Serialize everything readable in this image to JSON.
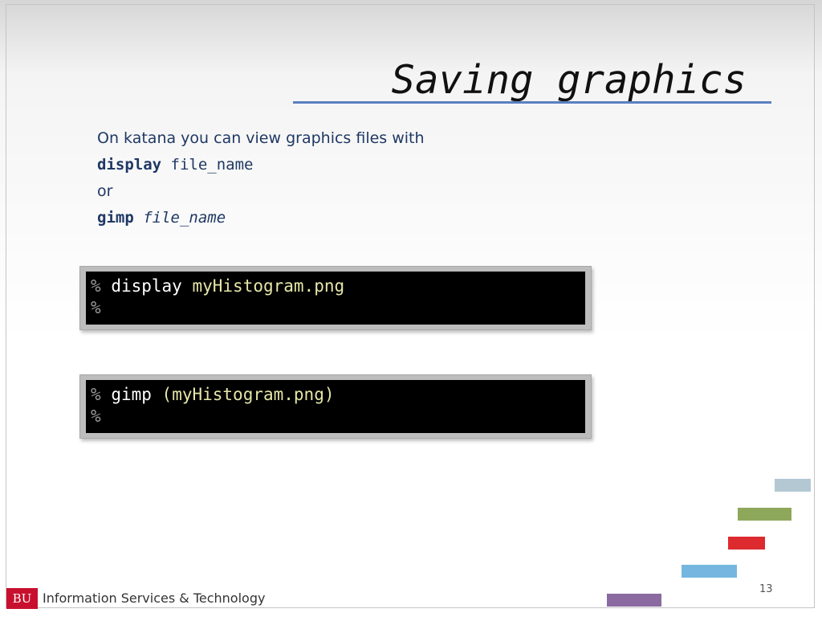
{
  "slide": {
    "title": "Saving graphics",
    "intro": "On katana you can view graphics files with",
    "line1": {
      "cmd": "display",
      "arg": "file_name"
    },
    "or": "or",
    "line2": {
      "cmd": "gimp",
      "arg": "file_name"
    }
  },
  "terminals": [
    {
      "prompt": "%",
      "cmd": "display",
      "arg": "myHistogram.png",
      "prompt2": "%"
    },
    {
      "prompt": "%",
      "cmd": "gimp",
      "arg": "(myHistogram.png)",
      "prompt2": "%"
    }
  ],
  "decor": {
    "bar_colors": [
      "#b3c8d3",
      "#8da85a",
      "#dd2a2f",
      "#74b6e0",
      "#8a6aa1"
    ]
  },
  "footer": {
    "logo": "BU",
    "org": "Information Services & Technology",
    "page_number": "13"
  }
}
